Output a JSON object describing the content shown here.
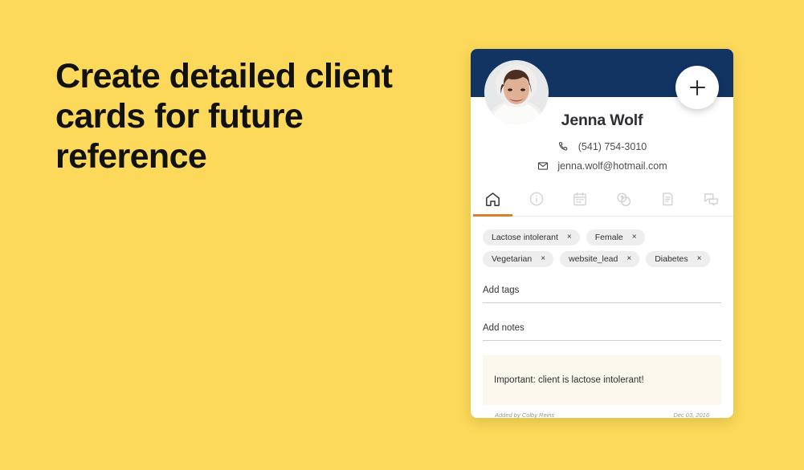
{
  "theme": {
    "background": "#fcd95b",
    "header_navy": "#123463",
    "accent_orange": "#dd7e28",
    "note_cream": "#fdf8ee",
    "chip_gray": "#eeeeee"
  },
  "headline": "Create detailed client cards for future reference",
  "card": {
    "add_button_label": "+",
    "client": {
      "name": "Jenna Wolf",
      "phone": "(541) 754-3010",
      "email": "jenna.wolf@hotmail.com"
    },
    "tabs": [
      {
        "id": "home",
        "icon": "home-icon",
        "active": true
      },
      {
        "id": "info",
        "icon": "info-icon",
        "active": false
      },
      {
        "id": "calendar",
        "icon": "calendar-icon",
        "active": false
      },
      {
        "id": "payments",
        "icon": "coins-icon",
        "active": false
      },
      {
        "id": "documents",
        "icon": "clipboard-icon",
        "active": false
      },
      {
        "id": "messages",
        "icon": "chat-icon",
        "active": false
      }
    ],
    "tags": [
      {
        "label": "Lactose intolerant",
        "remove": "×"
      },
      {
        "label": "Female",
        "remove": "×"
      },
      {
        "label": "Vegetarian",
        "remove": "×"
      },
      {
        "label": "website_lead",
        "remove": "×"
      },
      {
        "label": "Diabetes",
        "remove": "×"
      }
    ],
    "fields": {
      "tags_placeholder": "Add tags",
      "tags_value": "",
      "notes_placeholder": "Add notes",
      "notes_value": ""
    },
    "note": {
      "text": "Important: client is lactose intolerant!"
    },
    "footer": {
      "added_by": "Added by Colby Reins",
      "date": "Dec 03, 2016"
    }
  }
}
